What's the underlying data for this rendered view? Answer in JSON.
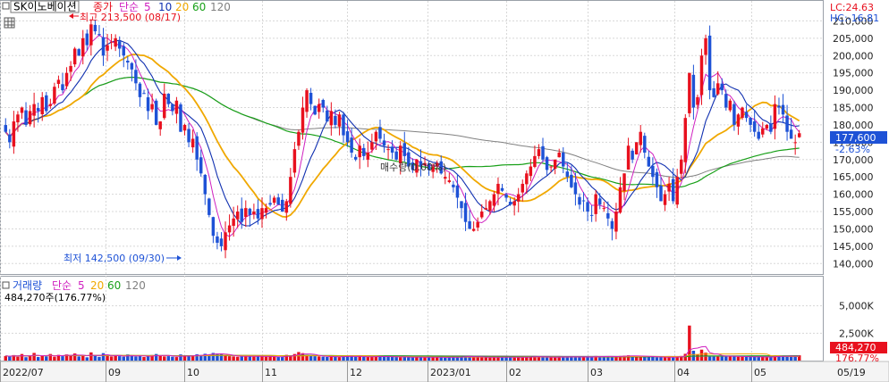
{
  "header": {
    "stock_name": "SK이노베이션",
    "price_label": "종가",
    "ma_label": "단순",
    "ma_periods": [
      "5",
      "10",
      "20",
      "60",
      "120"
    ],
    "lc": "LC:24.63",
    "hc": "HC:-16.81"
  },
  "volume_header": {
    "label": "거래량",
    "ma_label": "단순",
    "ma_periods": [
      "5",
      "20",
      "60",
      "120"
    ],
    "current": "484,270주(176.77%)"
  },
  "annotations": {
    "high": "최고 213,500 (08/17)",
    "low": "최저 142,500 (09/30)",
    "order_label": "매수량(0.00%)"
  },
  "badges": {
    "price": "177,600",
    "price_change": "-2.63%",
    "volume": "484,270",
    "volume_change": "176.77%"
  },
  "colors": {
    "up": "#e8101e",
    "down": "#1e52d6",
    "ma5": "#d020c0",
    "ma10": "#1030b0",
    "ma20": "#f0a800",
    "ma60": "#18a018",
    "ma120": "#808080",
    "grid": "#d8d8d8",
    "badge": "#1e52d6"
  },
  "chart_data": {
    "type": "candlestick",
    "price_axis": {
      "ticks": [
        "140,000",
        "145,000",
        "150,000",
        "155,000",
        "160,000",
        "165,000",
        "170,000",
        "175,000",
        "180,000",
        "185,000",
        "190,000",
        "195,000",
        "200,000",
        "205,000",
        "210,000"
      ],
      "ylim": [
        137500,
        215000
      ]
    },
    "volume_axis": {
      "ticks": [
        "2,500K",
        "5,000K"
      ],
      "ylim": [
        0,
        7500
      ]
    },
    "x_labels": [
      "2022/07",
      "09",
      "10",
      "11",
      "12",
      "2023/01",
      "02",
      "03",
      "04",
      "05",
      "05/19"
    ],
    "close": [
      178000,
      175000,
      181000,
      183000,
      185000,
      180000,
      184000,
      186000,
      184000,
      188000,
      184000,
      186000,
      191000,
      193000,
      190000,
      195000,
      197000,
      202000,
      200000,
      205000,
      203000,
      209000,
      207000,
      206000,
      200000,
      203000,
      204000,
      205000,
      202000,
      200000,
      198000,
      196000,
      192000,
      188000,
      189000,
      184000,
      186000,
      180000,
      181000,
      189000,
      186000,
      184000,
      187000,
      178000,
      180000,
      175000,
      176000,
      170000,
      166000,
      160000,
      154000,
      148000,
      146000,
      145000,
      149000,
      151000,
      153000,
      155000,
      152000,
      156000,
      154000,
      155000,
      153000,
      156000,
      156000,
      157000,
      159000,
      157000,
      155000,
      158000,
      165000,
      173000,
      178000,
      185000,
      190000,
      186000,
      183000,
      186000,
      185000,
      181000,
      184000,
      180000,
      183000,
      177000,
      175000,
      172000,
      170000,
      174000,
      171000,
      172000,
      175000,
      178000,
      176000,
      174000,
      173000,
      172000,
      170000,
      174000,
      171000,
      168000,
      167000,
      170000,
      168000,
      169000,
      167000,
      168000,
      169000,
      166000,
      165000,
      164000,
      162000,
      159000,
      156000,
      152000,
      150000,
      150000,
      152000,
      155000,
      156000,
      158000,
      160000,
      163000,
      161000,
      159000,
      157000,
      158000,
      160000,
      163000,
      166000,
      168000,
      171000,
      173000,
      170000,
      167000,
      168000,
      170000,
      172000,
      168000,
      165000,
      162000,
      160000,
      157000,
      158000,
      155000,
      154000,
      160000,
      157000,
      156000,
      153000,
      150000,
      155000,
      162000,
      166000,
      174000,
      170000,
      175000,
      178000,
      172000,
      168000,
      165000,
      162000,
      158000,
      160000,
      163000,
      158000,
      165000,
      170000,
      182000,
      195000,
      185000,
      188000,
      200000,
      205000,
      190000,
      188000,
      192000,
      190000,
      185000,
      187000,
      180000,
      183000,
      185000,
      182000,
      180000,
      178000,
      176000,
      179000,
      180000,
      178000,
      186000,
      185000,
      183000,
      178000,
      176000,
      175000,
      177600
    ],
    "volume": [
      420,
      380,
      500,
      350,
      600,
      310,
      450,
      700,
      330,
      420,
      380,
      600,
      350,
      520,
      400,
      560,
      480,
      650,
      380,
      420,
      300,
      750,
      500,
      340,
      680,
      420,
      380,
      450,
      400,
      350,
      560,
      450,
      380,
      420,
      330,
      400,
      500,
      600,
      450,
      380,
      400,
      350,
      320,
      560,
      420,
      380,
      450,
      580,
      490,
      620,
      540,
      700,
      650,
      580,
      450,
      400,
      380,
      350,
      420,
      410,
      390,
      360,
      400,
      380,
      350,
      370,
      330,
      340,
      360,
      520,
      450,
      600,
      780,
      680,
      520,
      440,
      400,
      380,
      350,
      330,
      360,
      380,
      320,
      400,
      420,
      380,
      350,
      360,
      330,
      340,
      380,
      370,
      400,
      350,
      330,
      360,
      320,
      310,
      340,
      300,
      290,
      350,
      300,
      310,
      290,
      300,
      320,
      280,
      270,
      300,
      350,
      330,
      360,
      420,
      380,
      310,
      300,
      320,
      290,
      280,
      300,
      350,
      330,
      310,
      290,
      280,
      300,
      320,
      340,
      360,
      380,
      330,
      300,
      290,
      310,
      330,
      360,
      340,
      310,
      350,
      320,
      340,
      300,
      310,
      330,
      420,
      400,
      380,
      360,
      330,
      380,
      420,
      450,
      480,
      400,
      380,
      370,
      410,
      360,
      330,
      300,
      290,
      310,
      320,
      280,
      380,
      420,
      620,
      3200,
      900,
      560,
      1000,
      720,
      430,
      400,
      450,
      380,
      390,
      410,
      380,
      350,
      360,
      340,
      330,
      360,
      320,
      330,
      310,
      320,
      480,
      420,
      380,
      400,
      390,
      420,
      484
    ]
  }
}
